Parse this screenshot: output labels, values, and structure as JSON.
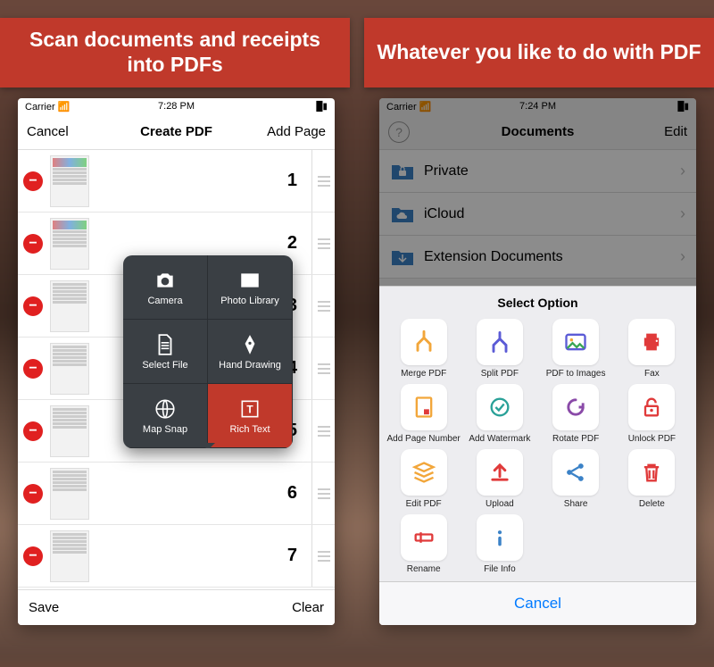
{
  "banners": {
    "left": "Scan documents and receipts into PDFs",
    "right": "Whatever you like to do with PDF"
  },
  "left_screen": {
    "status": {
      "carrier": "Carrier",
      "time": "7:28 PM"
    },
    "nav": {
      "cancel": "Cancel",
      "title": "Create PDF",
      "add": "Add Page"
    },
    "rows": [
      "1",
      "2",
      "3",
      "4",
      "5",
      "6",
      "7"
    ],
    "toolbar": {
      "save": "Save",
      "clear": "Clear"
    },
    "popover": {
      "camera": "Camera",
      "photo_library": "Photo Library",
      "select_file": "Select File",
      "hand_drawing": "Hand Drawing",
      "map_snap": "Map Snap",
      "rich_text": "Rich Text"
    }
  },
  "right_screen": {
    "status": {
      "carrier": "Carrier",
      "time": "7:24 PM"
    },
    "nav": {
      "title": "Documents",
      "edit": "Edit"
    },
    "folders": {
      "private": "Private",
      "icloud": "iCloud",
      "extension": "Extension Documents"
    },
    "sheet_title": "Select Option",
    "options": {
      "merge": "Merge PDF",
      "split": "Split PDF",
      "to_images": "PDF to Images",
      "fax": "Fax",
      "page_number": "Add Page Number",
      "watermark": "Add Watermark",
      "rotate": "Rotate PDF",
      "unlock": "Unlock PDF",
      "edit": "Edit PDF",
      "upload": "Upload",
      "share": "Share",
      "delete": "Delete",
      "rename": "Rename",
      "file_info": "File Info"
    },
    "cancel": "Cancel"
  }
}
